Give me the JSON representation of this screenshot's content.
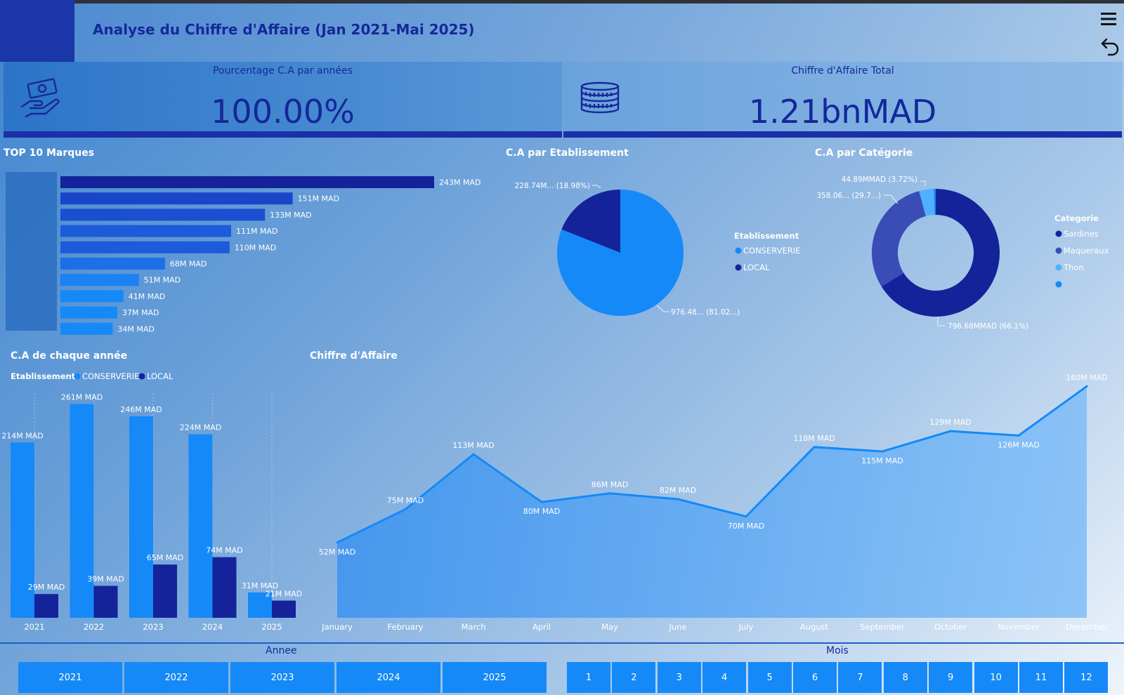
{
  "header": {
    "title": "Analyse du Chiffre d'Affaire (Jan 2021-Mai 2025)"
  },
  "kpis": [
    {
      "label": "Pourcentage C.A par années",
      "value": "100.00%",
      "icon": "money-hand-icon"
    },
    {
      "label": "Chiffre d'Affaire Total",
      "value": "1.21bnMAD",
      "icon": "coins-stack-icon"
    }
  ],
  "colors": {
    "dark": "#14239a",
    "bright": "#1589f7",
    "mid": "#1c62d8",
    "slate": "#3a4cb6",
    "light": "#4fb0ff"
  },
  "chart_data": [
    {
      "type": "bar",
      "orientation": "horizontal",
      "title": "TOP 10 Marques",
      "values": [
        243,
        151,
        133,
        111,
        110,
        68,
        51,
        41,
        37,
        34
      ],
      "labels": [
        "243M MAD",
        "151M MAD",
        "133M MAD",
        "111M MAD",
        "110M MAD",
        "68M MAD",
        "51M MAD",
        "41M MAD",
        "37M MAD",
        "34M MAD"
      ],
      "unit": "M MAD"
    },
    {
      "type": "pie",
      "title": "C.A par Etablissement",
      "legend_title": "Etablissement",
      "slices": [
        {
          "name": "CONSERVERIE",
          "value": 81.02,
          "label": "976.48... (81.02...)"
        },
        {
          "name": "LOCAL",
          "value": 18.98,
          "label": "228.74M... (18.98%)"
        }
      ]
    },
    {
      "type": "pie",
      "variant": "donut",
      "title": "C.A par Catégorie",
      "legend_title": "Categorie",
      "slices": [
        {
          "name": "Sardines",
          "value": 66.1,
          "label": "796.68MMAD (66.1%)"
        },
        {
          "name": "Maqueraux",
          "value": 29.7,
          "label": "358.06... (29.7...)"
        },
        {
          "name": "Thon",
          "value": 3.72,
          "label": "44.89MMAD (3.72%)"
        },
        {
          "name": "",
          "value": 0.48,
          "label": ""
        }
      ]
    },
    {
      "type": "bar",
      "title": "C.A de chaque année",
      "legend_title": "Etablissement",
      "categories": [
        "2021",
        "2022",
        "2023",
        "2024",
        "2025"
      ],
      "series": [
        {
          "name": "CONSERVERIE",
          "values": [
            214,
            261,
            246,
            224,
            31
          ],
          "labels": [
            "214M MAD",
            "261M MAD",
            "246M MAD",
            "224M MAD",
            "31M MAD"
          ]
        },
        {
          "name": "LOCAL",
          "values": [
            29,
            39,
            65,
            74,
            21
          ],
          "labels": [
            "29M MAD",
            "39M MAD",
            "65M MAD",
            "74M MAD",
            "21M MAD"
          ]
        }
      ],
      "ylim": [
        0,
        270
      ]
    },
    {
      "type": "area",
      "title": "Chiffre d'Affaire",
      "x": [
        "January",
        "February",
        "March",
        "April",
        "May",
        "June",
        "July",
        "August",
        "September",
        "October",
        "November",
        "December"
      ],
      "values": [
        52,
        75,
        113,
        80,
        86,
        82,
        70,
        118,
        115,
        129,
        126,
        160
      ],
      "labels": [
        "52M MAD",
        "75M MAD",
        "113M MAD",
        "80M MAD",
        "86M MAD",
        "82M MAD",
        "70M MAD",
        "118M MAD",
        "115M MAD",
        "129M MAD",
        "126M MAD",
        "160M MAD"
      ],
      "ylim": [
        0,
        165
      ]
    }
  ],
  "slicers": {
    "annee": {
      "title": "Annee",
      "options": [
        "2021",
        "2022",
        "2023",
        "2024",
        "2025"
      ]
    },
    "mois": {
      "title": "Mois",
      "options": [
        "1",
        "2",
        "3",
        "4",
        "5",
        "6",
        "7",
        "8",
        "9",
        "10",
        "11",
        "12"
      ]
    }
  }
}
